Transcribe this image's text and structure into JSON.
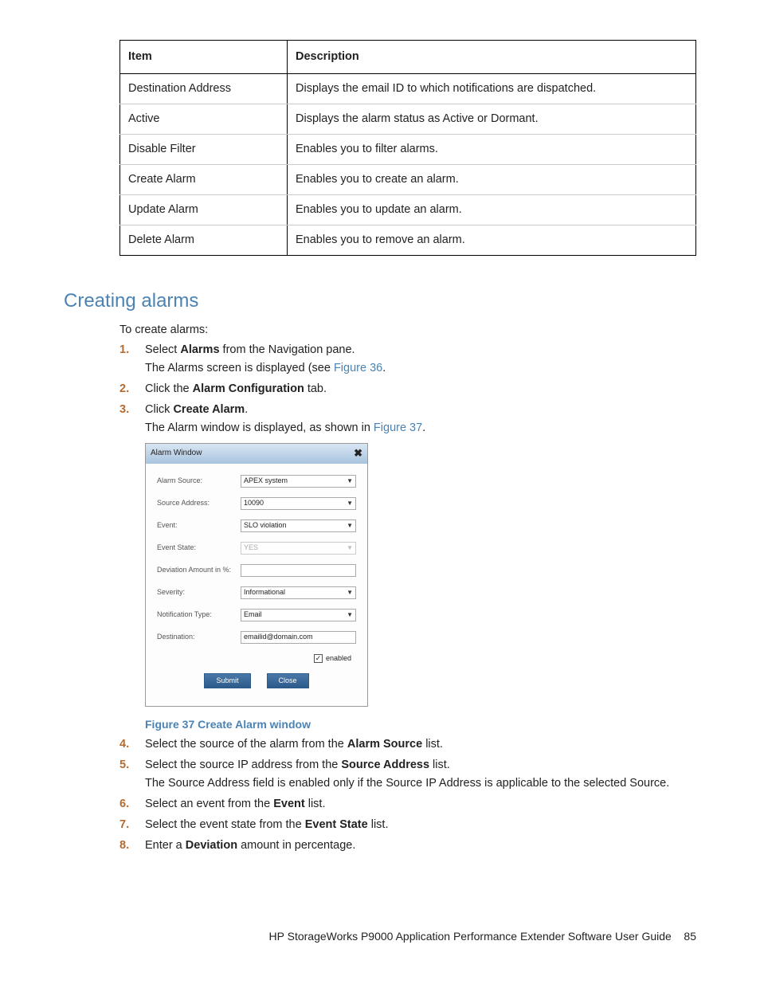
{
  "table": {
    "headers": [
      "Item",
      "Description"
    ],
    "rows": [
      {
        "item": "Destination Address",
        "desc": "Displays the email ID to which notifications are dispatched."
      },
      {
        "item": "Active",
        "desc": "Displays the alarm status as Active or Dormant."
      },
      {
        "item": "Disable Filter",
        "desc": "Enables you to filter alarms."
      },
      {
        "item": "Create Alarm",
        "desc": "Enables you to create an alarm."
      },
      {
        "item": "Update Alarm",
        "desc": "Enables you to update an alarm."
      },
      {
        "item": "Delete Alarm",
        "desc": "Enables you to remove an alarm."
      }
    ]
  },
  "section_title": "Creating alarms",
  "intro": "To create alarms:",
  "steps": {
    "s1_a": "Select ",
    "s1_bold": "Alarms",
    "s1_b": " from the Navigation pane.",
    "s1_sub": "The Alarms screen is displayed (see ",
    "s1_link": "Figure 36",
    "s1_end": ".",
    "s2_a": "Click the ",
    "s2_bold": "Alarm Configuration",
    "s2_b": " tab.",
    "s3_a": "Click ",
    "s3_bold": "Create Alarm",
    "s3_b": ".",
    "s3_sub": "The Alarm window is displayed, as shown in ",
    "s3_link": "Figure 37",
    "s3_end": ".",
    "s4_a": "Select the source of the alarm from the ",
    "s4_bold": "Alarm Source",
    "s4_b": " list.",
    "s5_a": "Select the source IP address from the ",
    "s5_bold": "Source Address",
    "s5_b": " list.",
    "s5_sub": "The Source Address field is enabled only if the Source IP Address is applicable to the selected Source.",
    "s6_a": "Select an event from the ",
    "s6_bold": "Event",
    "s6_b": " list.",
    "s7_a": "Select the event state from the ",
    "s7_bold": "Event State",
    "s7_b": " list.",
    "s8_a": "Enter a ",
    "s8_bold": "Deviation",
    "s8_b": " amount in percentage."
  },
  "alarm_window": {
    "title": "Alarm Window",
    "close_glyph": "✖",
    "fields": {
      "alarm_source": {
        "label": "Alarm Source:",
        "value": "APEX system"
      },
      "source_address": {
        "label": "Source Address:",
        "value": "10090"
      },
      "event": {
        "label": "Event:",
        "value": "SLO violation"
      },
      "event_state": {
        "label": "Event State:",
        "value": "YES"
      },
      "deviation": {
        "label": "Deviation Amount in %:",
        "value": ""
      },
      "severity": {
        "label": "Severity:",
        "value": "Informational"
      },
      "notif_type": {
        "label": "Notification Type:",
        "value": "Email"
      },
      "destination": {
        "label": "Destination:",
        "value": "emailid@domain.com"
      }
    },
    "enabled_check": "✓",
    "enabled_label": "enabled",
    "submit": "Submit",
    "close": "Close"
  },
  "figure_caption": "Figure 37 Create Alarm window",
  "footer": {
    "text": "HP StorageWorks P9000 Application Performance Extender Software User Guide",
    "page": "85"
  }
}
